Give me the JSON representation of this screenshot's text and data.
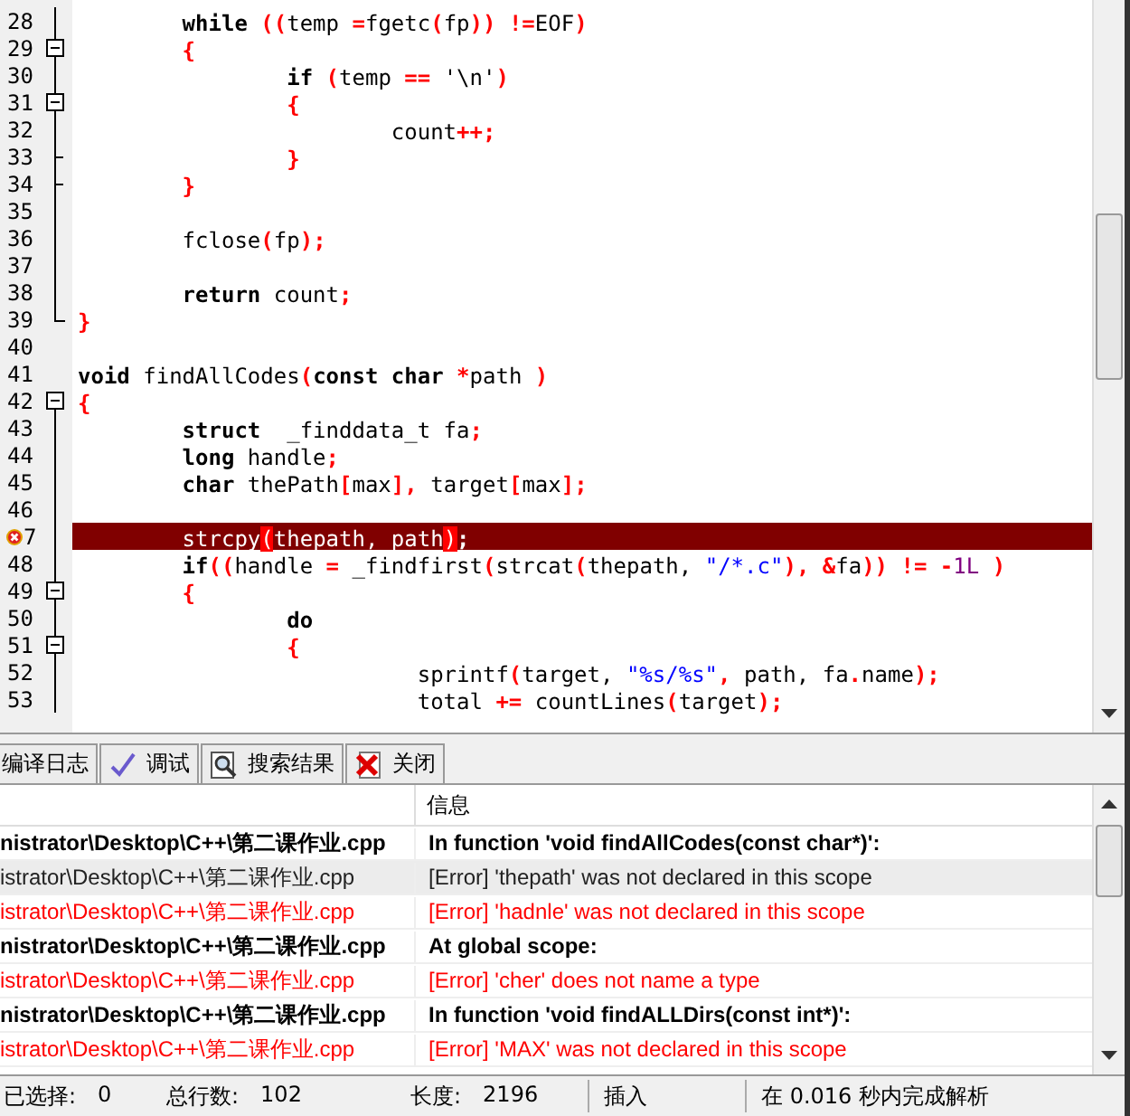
{
  "editor": {
    "lines": [
      {
        "number": "28",
        "fold": {
          "kind": "line"
        },
        "tokens": [
          {
            "text": "\t\twhile ",
            "kind": "kw"
          },
          {
            "text": "((",
            "kind": "op"
          },
          {
            "text": "temp ",
            "kind": "id"
          },
          {
            "text": "=",
            "kind": "op"
          },
          {
            "text": "fgetc",
            "kind": "id"
          },
          {
            "text": "(",
            "kind": "op"
          },
          {
            "text": "fp",
            "kind": "id"
          },
          {
            "text": ")) !=",
            "kind": "op"
          },
          {
            "text": "EOF",
            "kind": "id"
          },
          {
            "text": ")",
            "kind": "op"
          }
        ]
      },
      {
        "number": "29",
        "fold": {
          "kind": "open"
        },
        "tokens": [
          {
            "text": "\t\t{",
            "kind": "op"
          }
        ]
      },
      {
        "number": "30",
        "fold": {
          "kind": "line"
        },
        "tokens": [
          {
            "text": "\t\t\t\tif ",
            "kind": "kw"
          },
          {
            "text": "(",
            "kind": "op"
          },
          {
            "text": "temp ",
            "kind": "id"
          },
          {
            "text": "==",
            "kind": "op"
          },
          {
            "text": " '\\n'",
            "kind": "id"
          },
          {
            "text": ")",
            "kind": "op"
          }
        ]
      },
      {
        "number": "31",
        "fold": {
          "kind": "open"
        },
        "tokens": [
          {
            "text": "\t\t\t\t{",
            "kind": "op"
          }
        ]
      },
      {
        "number": "32",
        "fold": {
          "kind": "line"
        },
        "tokens": [
          {
            "text": "\t\t\t\t\t\tcount",
            "kind": "id"
          },
          {
            "text": "++;",
            "kind": "op"
          }
        ]
      },
      {
        "number": "33",
        "fold": {
          "kind": "end"
        },
        "tokens": [
          {
            "text": "\t\t\t\t}",
            "kind": "op"
          }
        ]
      },
      {
        "number": "34",
        "fold": {
          "kind": "end"
        },
        "tokens": [
          {
            "text": "\t\t}",
            "kind": "op"
          }
        ]
      },
      {
        "number": "35",
        "fold": {
          "kind": "line"
        }
      },
      {
        "number": "36",
        "fold": {
          "kind": "line"
        },
        "tokens": [
          {
            "text": "\t\tfclose",
            "kind": "id"
          },
          {
            "text": "(",
            "kind": "op"
          },
          {
            "text": "fp",
            "kind": "id"
          },
          {
            "text": ");",
            "kind": "op"
          }
        ]
      },
      {
        "number": "37",
        "fold": {
          "kind": "line"
        }
      },
      {
        "number": "38",
        "fold": {
          "kind": "line"
        },
        "tokens": [
          {
            "text": "\t\treturn",
            "kind": "kw"
          },
          {
            "text": " count",
            "kind": "id"
          },
          {
            "text": ";",
            "kind": "op"
          }
        ]
      },
      {
        "number": "39",
        "fold": {
          "kind": "last"
        },
        "tokens": [
          {
            "text": "}",
            "kind": "op"
          }
        ]
      },
      {
        "number": "40",
        "fold": {
          "kind": "none"
        }
      },
      {
        "number": "41",
        "fold": {
          "kind": "none"
        },
        "tokens": [
          {
            "text": "void",
            "kind": "kw"
          },
          {
            "text": " findAllCodes",
            "kind": "id"
          },
          {
            "text": "(",
            "kind": "op"
          },
          {
            "text": "const char ",
            "kind": "kw"
          },
          {
            "text": "*",
            "kind": "op"
          },
          {
            "text": "path ",
            "kind": "id"
          },
          {
            "text": ")",
            "kind": "op"
          }
        ]
      },
      {
        "number": "42",
        "fold": {
          "kind": "first"
        },
        "tokens": [
          {
            "text": "{",
            "kind": "op"
          }
        ]
      },
      {
        "number": "43",
        "fold": {
          "kind": "line"
        },
        "tokens": [
          {
            "text": "\t\tstruct",
            "kind": "kw"
          },
          {
            "text": "  _finddata_t fa",
            "kind": "id"
          },
          {
            "text": ";",
            "kind": "op"
          }
        ]
      },
      {
        "number": "44",
        "fold": {
          "kind": "line"
        },
        "tokens": [
          {
            "text": "\t\tlong",
            "kind": "kw"
          },
          {
            "text": " handle",
            "kind": "id"
          },
          {
            "text": ";",
            "kind": "op"
          }
        ]
      },
      {
        "number": "45",
        "fold": {
          "kind": "line"
        },
        "tokens": [
          {
            "text": "\t\tchar",
            "kind": "kw"
          },
          {
            "text": " thePath",
            "kind": "id"
          },
          {
            "text": "[",
            "kind": "op"
          },
          {
            "text": "max",
            "kind": "id"
          },
          {
            "text": "],",
            "kind": "op"
          },
          {
            "text": " target",
            "kind": "id"
          },
          {
            "text": "[",
            "kind": "op"
          },
          {
            "text": "max",
            "kind": "id"
          },
          {
            "text": "];",
            "kind": "op"
          }
        ]
      },
      {
        "number": "46",
        "fold": {
          "kind": "line"
        }
      },
      {
        "number": "7",
        "fold": {
          "kind": "line"
        },
        "error": true,
        "tokens": [
          {
            "text": "\t\tstrcpy",
            "kind": "id"
          },
          {
            "text": "(",
            "kind": "match"
          },
          {
            "text": "thepath, path",
            "kind": "id"
          },
          {
            "text": ")",
            "kind": "match"
          },
          {
            "text": ";",
            "kind": "op"
          }
        ]
      },
      {
        "number": "48",
        "fold": {
          "kind": "line"
        },
        "tokens": [
          {
            "text": "\t\tif",
            "kind": "kw"
          },
          {
            "text": "((",
            "kind": "op"
          },
          {
            "text": "handle ",
            "kind": "id"
          },
          {
            "text": "=",
            "kind": "op"
          },
          {
            "text": " _findfirst",
            "kind": "id"
          },
          {
            "text": "(",
            "kind": "op"
          },
          {
            "text": "strcat",
            "kind": "id"
          },
          {
            "text": "(",
            "kind": "op"
          },
          {
            "text": "thepath, ",
            "kind": "id"
          },
          {
            "text": "\"/*.c\"",
            "kind": "str"
          },
          {
            "text": "), &",
            "kind": "op"
          },
          {
            "text": "fa",
            "kind": "id"
          },
          {
            "text": ")) != -",
            "kind": "op"
          },
          {
            "text": "1L",
            "kind": "num"
          },
          {
            "text": " )",
            "kind": "op"
          }
        ]
      },
      {
        "number": "49",
        "fold": {
          "kind": "open"
        },
        "tokens": [
          {
            "text": "\t\t{",
            "kind": "op"
          }
        ]
      },
      {
        "number": "50",
        "fold": {
          "kind": "line"
        },
        "tokens": [
          {
            "text": "\t\t\t\tdo",
            "kind": "kw"
          }
        ]
      },
      {
        "number": "51",
        "fold": {
          "kind": "open"
        },
        "tokens": [
          {
            "text": "\t\t\t\t{",
            "kind": "op"
          }
        ]
      },
      {
        "number": "52",
        "fold": {
          "kind": "line"
        },
        "tokens": [
          {
            "text": "\t\t\t\t\t\t  sprintf",
            "kind": "id"
          },
          {
            "text": "(",
            "kind": "op"
          },
          {
            "text": "target, ",
            "kind": "id"
          },
          {
            "text": "\"%s/%s\"",
            "kind": "str"
          },
          {
            "text": ",",
            "kind": "op"
          },
          {
            "text": " path, fa",
            "kind": "id"
          },
          {
            "text": ".",
            "kind": "op"
          },
          {
            "text": "name",
            "kind": "id"
          },
          {
            "text": ");",
            "kind": "op"
          }
        ]
      },
      {
        "number": "53",
        "fold": {
          "kind": "line"
        },
        "tokens": [
          {
            "text": "\t\t\t\t\t\t  total ",
            "kind": "id"
          },
          {
            "text": "+=",
            "kind": "op"
          },
          {
            "text": " countLines",
            "kind": "id"
          },
          {
            "text": "(",
            "kind": "op"
          },
          {
            "text": "target",
            "kind": "id"
          },
          {
            "text": ");",
            "kind": "op"
          }
        ]
      }
    ]
  },
  "tabs": [
    {
      "label": "编译日志"
    },
    {
      "label": "调试"
    },
    {
      "label": "搜索结果"
    },
    {
      "label": "关闭"
    }
  ],
  "table": {
    "header": "信息",
    "rows": [
      {
        "kind": "heading",
        "selected": false,
        "file": "nistrator\\Desktop\\C++\\第二课作业.cpp",
        "message": "In function 'void findAllCodes(const char*)':"
      },
      {
        "kind": "error",
        "selected": true,
        "file": "istrator\\Desktop\\C++\\第二课作业.cpp",
        "message": "[Error] 'thepath' was not declared in this scope"
      },
      {
        "kind": "error",
        "selected": false,
        "file": "istrator\\Desktop\\C++\\第二课作业.cpp",
        "message": "[Error] 'hadnle' was not declared in this scope"
      },
      {
        "kind": "heading",
        "selected": false,
        "file": "nistrator\\Desktop\\C++\\第二课作业.cpp",
        "message": "At global scope:"
      },
      {
        "kind": "error",
        "selected": false,
        "file": "istrator\\Desktop\\C++\\第二课作业.cpp",
        "message": "[Error] 'cher' does not name a type"
      },
      {
        "kind": "heading",
        "selected": false,
        "file": "nistrator\\Desktop\\C++\\第二课作业.cpp",
        "message": "In function 'void findALLDirs(const int*)':"
      },
      {
        "kind": "error",
        "selected": false,
        "file": "istrator\\Desktop\\C++\\第二课作业.cpp",
        "message": "[Error] 'MAX' was not declared in this scope"
      }
    ]
  },
  "status_bar": {
    "fields": [
      {
        "label": "已选择:",
        "value": "0"
      },
      {
        "label": "总行数:",
        "value": "102"
      },
      {
        "label": "长度:",
        "value": "2196"
      }
    ],
    "mode": "插入",
    "message": "在 0.016 秒内完成解析"
  }
}
